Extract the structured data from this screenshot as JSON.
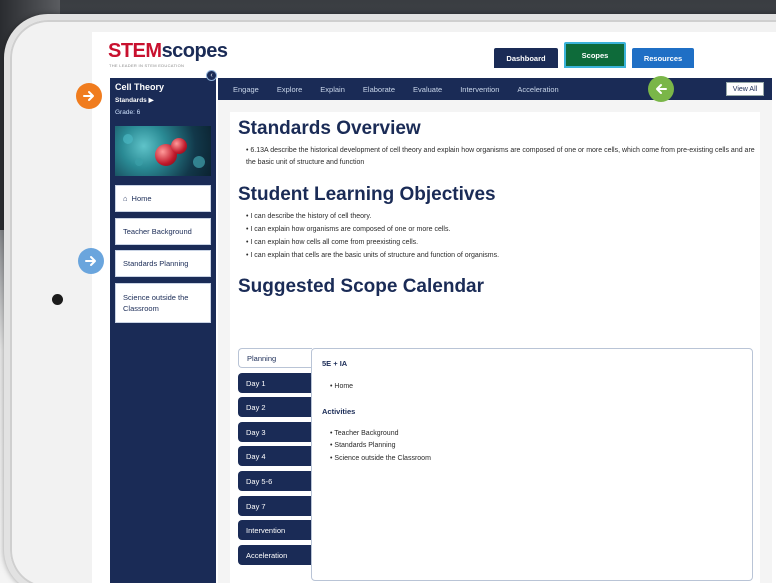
{
  "header": {
    "logo_stem": "STEM",
    "logo_scopes": "scopes",
    "logo_tagline": "THE LEADER IN STEM EDUCATION",
    "tabs": [
      {
        "label": "Dashboard"
      },
      {
        "label": "Scopes"
      },
      {
        "label": "Resources"
      }
    ]
  },
  "sidebar": {
    "unit_title": "Cell Theory",
    "unit_sub": "Standards ▶",
    "grade": "Grade: 6",
    "items": [
      {
        "label": "Home"
      },
      {
        "label": "Teacher Background"
      },
      {
        "label": "Standards Planning"
      },
      {
        "label": "Science outside the Classroom"
      }
    ]
  },
  "subnav": {
    "items": [
      "Engage",
      "Explore",
      "Explain",
      "Elaborate",
      "Evaluate",
      "Intervention",
      "Acceleration"
    ],
    "view_all": "View All"
  },
  "main": {
    "standards_title": "Standards Overview",
    "standards": [
      "6.13A describe the historical development of cell theory and explain how organisms are composed of one or more cells, which come from pre-existing cells and are the basic unit of structure and function"
    ],
    "objectives_title": "Student Learning Objectives",
    "objectives": [
      "I can describe the history of cell theory.",
      "I can explain how organisms are composed of one or more cells.",
      "I can explain how cells all come from preexisting cells.",
      "I can explain that cells are the basic units of structure and function of organisms."
    ],
    "calendar_title": "Suggested Scope Calendar",
    "calendar_tabs": [
      "Planning",
      "Day 1",
      "Day 2",
      "Day 3",
      "Day 4",
      "Day 5-6",
      "Day 7",
      "Intervention",
      "Acceleration"
    ],
    "calendar_panel": {
      "heading1": "5E + IA",
      "list1": [
        "Home"
      ],
      "heading2": "Activities",
      "list2": [
        "Teacher Background",
        "Standards Planning",
        "Science outside the Classroom"
      ]
    }
  },
  "colors": {
    "navy": "#1a2b56",
    "scopes_green": "#0e6b3a",
    "resources_blue": "#1f6fc5",
    "orange_arrow": "#f07c1e",
    "blue_arrow": "#6aa5dd",
    "green_arrow": "#7ab648"
  }
}
